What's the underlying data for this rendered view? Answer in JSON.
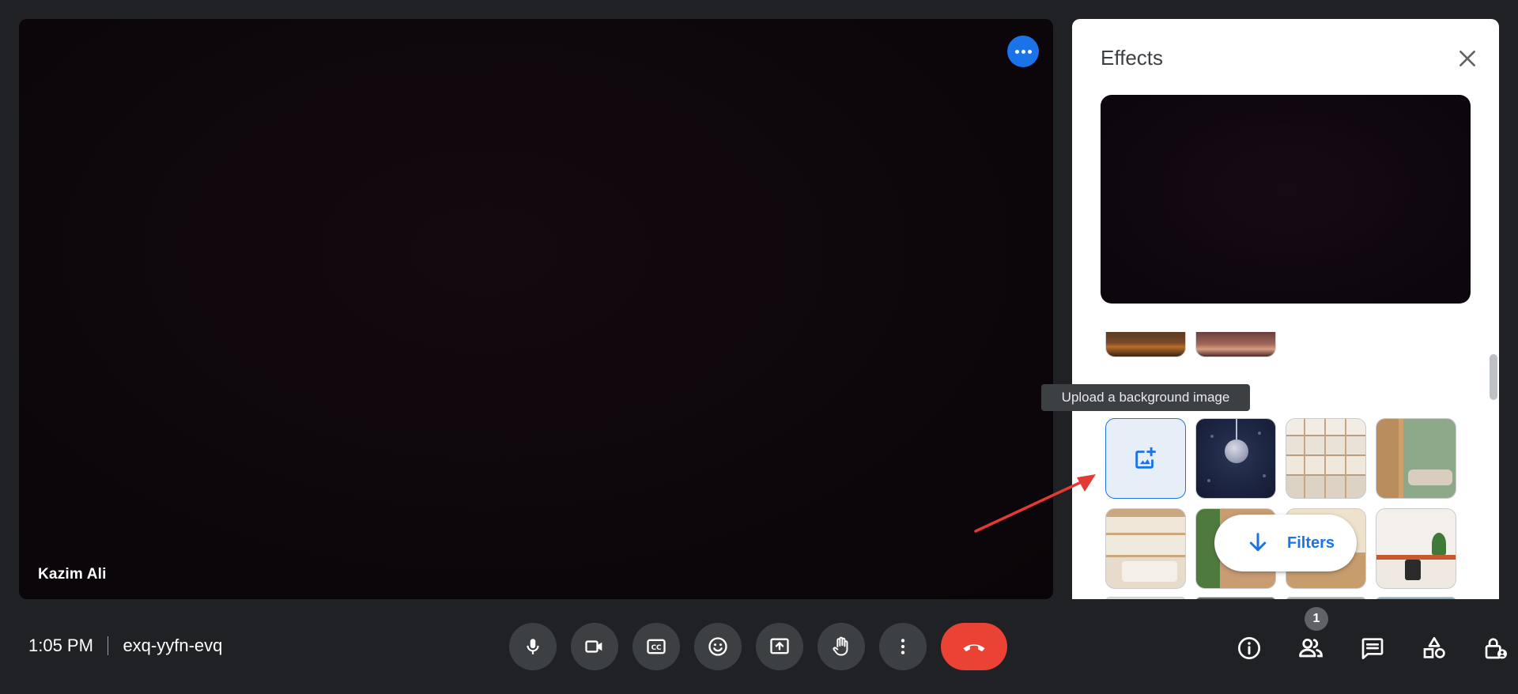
{
  "video": {
    "participant_name": "Kazim Ali",
    "more_icon": "more-horizontal-icon"
  },
  "effects": {
    "title": "Effects",
    "close_icon": "close-icon",
    "upload_tooltip": "Upload a background image",
    "upload_icon": "add-photo-icon",
    "filters_label": "Filters",
    "filters_icon": "arrow-down-icon",
    "backgrounds": [
      "upload",
      "christmas-ornament",
      "bookshelves",
      "living-room",
      "bookshelves-bedroom",
      "plant-room",
      "cozy-room",
      "home-office-desk"
    ]
  },
  "meeting": {
    "time": "1:05 PM",
    "code": "exq-yyfn-evq"
  },
  "controls": [
    {
      "name": "microphone",
      "icon": "mic-icon"
    },
    {
      "name": "camera",
      "icon": "videocam-icon"
    },
    {
      "name": "captions",
      "icon": "closed-captions-icon"
    },
    {
      "name": "reactions",
      "icon": "emoji-icon"
    },
    {
      "name": "present",
      "icon": "present-screen-icon"
    },
    {
      "name": "raise-hand",
      "icon": "hand-icon"
    },
    {
      "name": "more-options",
      "icon": "more-vertical-icon"
    },
    {
      "name": "leave-call",
      "icon": "call-end-icon"
    }
  ],
  "right_tools": {
    "people_count": "1",
    "icons": [
      "info-icon",
      "people-icon",
      "chat-icon",
      "activities-icon",
      "host-controls-icon"
    ]
  },
  "colors": {
    "accent": "#1a73e8",
    "end_call": "#ea4335",
    "background": "#202124",
    "annotation": "#e53935"
  }
}
